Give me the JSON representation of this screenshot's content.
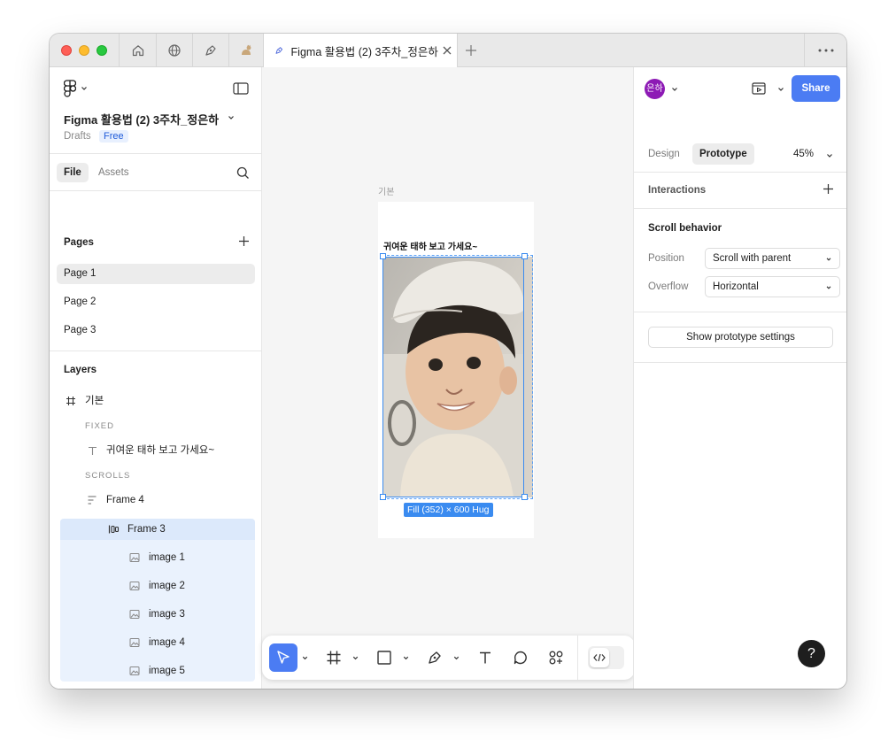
{
  "titlebar": {
    "active_tab_title": "Figma 활용법 (2) 3주차_정은하",
    "icons": [
      "home-icon",
      "globe-icon",
      "pen-icon",
      "cat-icon"
    ]
  },
  "file": {
    "name": "Figma 활용법 (2) 3주차_정은하",
    "location": "Drafts",
    "plan_badge": "Free"
  },
  "left_tabs": {
    "file": "File",
    "assets": "Assets"
  },
  "pages": {
    "heading": "Pages",
    "items": [
      "Page 1",
      "Page 2",
      "Page 3"
    ],
    "selected": "Page 1"
  },
  "layers": {
    "heading": "Layers",
    "frame": "기본",
    "fixed_label": "FIXED",
    "text_layer": "귀여운 태하 보고 가세요~",
    "scrolls_label": "SCROLLS",
    "frame4": "Frame 4",
    "frame3": "Frame 3",
    "images": [
      "image 1",
      "image 2",
      "image 3",
      "image 4",
      "image 5"
    ]
  },
  "canvas": {
    "frame_label": "기본",
    "frame_text": "귀여운 태하 보고 가세요~",
    "size_tag": "Fill (352) × 600 Hug"
  },
  "right_panel": {
    "avatar_text": "은하",
    "share_label": "Share",
    "tab_design": "Design",
    "tab_prototype": "Prototype",
    "zoom": "45%",
    "interactions_label": "Interactions",
    "scroll_behavior_label": "Scroll behavior",
    "position_label": "Position",
    "position_value": "Scroll with parent",
    "overflow_label": "Overflow",
    "overflow_value": "Horizontal",
    "prototype_settings_button": "Show prototype settings",
    "help_label": "?"
  },
  "colors": {
    "accent": "#4b7cf3",
    "selection": "#3a8bf0",
    "avatar": "#8d1ab5"
  }
}
